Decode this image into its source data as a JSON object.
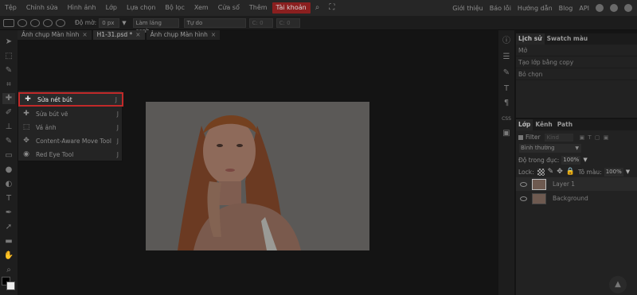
{
  "menubar": {
    "items": [
      "Tệp",
      "Chỉnh sửa",
      "Hình ảnh",
      "Lớp",
      "Lựa chọn",
      "Bộ lọc",
      "Xem",
      "Cửa sổ",
      "Thêm",
      "Tài khoản"
    ],
    "active_item": "Tài khoản",
    "right_links": [
      "Giới thiệu",
      "Báo lỗi",
      "Hướng dẫn",
      "Blog",
      "API"
    ]
  },
  "options": {
    "hardness_label": "Độ mờ:",
    "hardness_value": "0 px",
    "button_label": "Làm láng cạnh",
    "mode_value": "Tự do",
    "c_label_1": "C: 0",
    "c_label_2": "C: 0"
  },
  "tabs": [
    {
      "label": "Ảnh chụp Màn hình",
      "close": "×"
    },
    {
      "label": "H1-31.psd *",
      "close": "×"
    },
    {
      "label": "Ảnh chụp Màn hình",
      "close": "×"
    }
  ],
  "flyout": {
    "items": [
      {
        "label": "Sửa nét bút",
        "key": "J",
        "icon": "healing-brush-icon"
      },
      {
        "label": "Sửa bút vẽ",
        "key": "J",
        "icon": "spot-healing-icon"
      },
      {
        "label": "Vá ảnh",
        "key": "J",
        "icon": "patch-icon"
      },
      {
        "label": "Content-Aware Move Tool",
        "key": "J",
        "icon": "content-aware-move-icon"
      },
      {
        "label": "Red Eye Tool",
        "key": "J",
        "icon": "red-eye-icon"
      }
    ],
    "highlight_color": "#c12a2a"
  },
  "history": {
    "tabs": [
      "Lịch sử",
      "Swatch màu"
    ],
    "rows": [
      "Mở",
      "Tạo lớp bằng copy",
      "Bỏ chọn"
    ]
  },
  "layers": {
    "tabs": [
      "Lớp",
      "Kênh",
      "Path"
    ],
    "filter_label": "Filter",
    "filter_kind": "Kind",
    "blend_mode": "Bình thường",
    "opacity_label": "Độ trong đục:",
    "opacity_value": "100%",
    "lock_label": "Lock:",
    "fill_label": "Tô màu:",
    "fill_value": "100%",
    "rows": [
      "Layer 1",
      "Background"
    ]
  },
  "colors": {
    "accent_red": "#8a1f1f"
  }
}
